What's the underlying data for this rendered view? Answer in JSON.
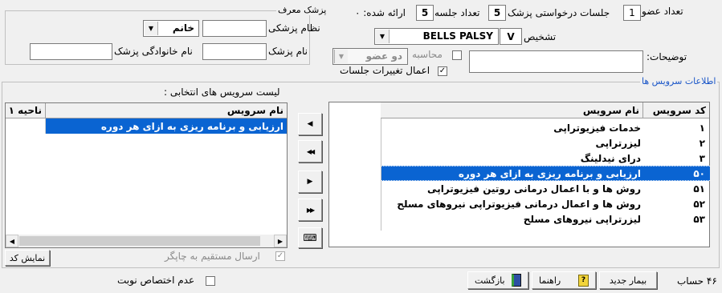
{
  "header": {
    "member_count_label": "تعداد عضو",
    "member_count_value": "1",
    "requested_sessions_label": "جلسات درخواستی پزشک",
    "requested_sessions_value": "5",
    "session_count_label": "تعداد جلسه",
    "session_count_value": "5",
    "delivered_label": "ارائه شده: ٠",
    "diagnosis_label": "تشخیص",
    "diagnosis_code": "V",
    "diagnosis_value": "BELLS PALSY",
    "description_label": "توضیحات:",
    "calculation_label": "محاسبه",
    "calculation_value": "دو عضو",
    "apply_changes_label": "اعمال تغییرات جلسات",
    "apply_changes_checked": "✓"
  },
  "referrer": {
    "group_title": "پزشک معرف",
    "medical_system_label": "نظام پزشکی",
    "gender_value": "خانم",
    "doctor_name_label": "نام پزشک",
    "doctor_family_label": "نام خانوادگی پزشک"
  },
  "services": {
    "group_title": "اطلاعات سرویس ها",
    "available": {
      "col_code": "کد سرویس",
      "col_name": "نام سرویس",
      "rows": [
        {
          "code": "١",
          "name": "خدمات فیزیوتراپی"
        },
        {
          "code": "٢",
          "name": "لیزرتراپی"
        },
        {
          "code": "٣",
          "name": "درای نیدلینگ"
        },
        {
          "code": "۵٠",
          "name": "ارزیابی و برنامه ریزی به ازای هر دوره"
        },
        {
          "code": "۵١",
          "name": "روش ها و با اعمال درمانی روتین فیزیوتراپی"
        },
        {
          "code": "۵٢",
          "name": "روش ها و اعمال درمانی فیزیوتراپی نیروهای مسلح"
        },
        {
          "code": "۵٣",
          "name": "لیزرتراپی نیروهای مسلح"
        }
      ]
    },
    "selected": {
      "title": "لیست سرویس های انتخابی :",
      "col_name": "نام سرویس",
      "col_region": "ناحیه ١",
      "rows": [
        {
          "name": "ارزیابی و برنامه ریزی به ازای هر دوره",
          "region": ""
        }
      ]
    },
    "move_buttons": {
      "move_one_right": "▶",
      "move_all_left": "◀◀",
      "move_one_left": "▶",
      "move_all_right": "▶▶"
    },
    "direct_print_label": "ارسال مستقیم به چاپگر",
    "direct_print_check": "✓",
    "show_code_button": "نمایش کد"
  },
  "footer": {
    "account_label": "۴۶ حساب",
    "new_patient_button": "بیمار جدید",
    "help_button": "راهنما",
    "back_button": "بازگشت",
    "no_appointment_label": "عدم اختصاص نوبت"
  }
}
